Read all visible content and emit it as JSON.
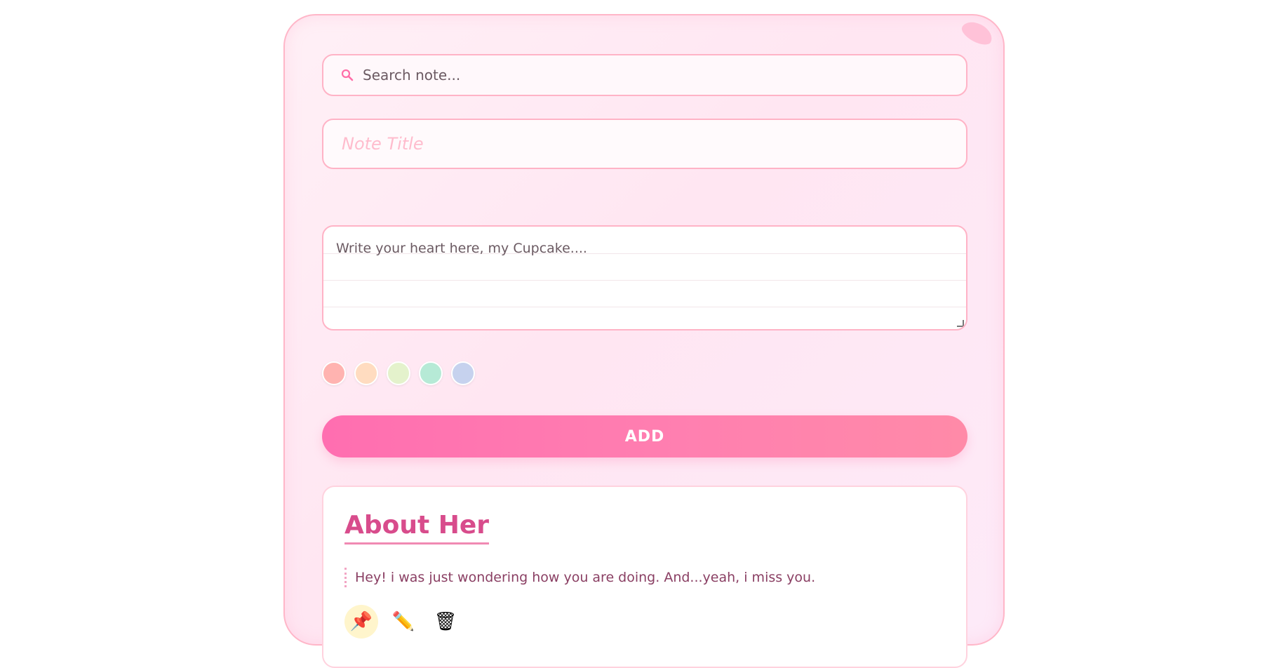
{
  "search": {
    "placeholder": "Search note..."
  },
  "editor": {
    "title_placeholder": "Note Title",
    "body_placeholder": "Write your heart here, my Cupcake...."
  },
  "colors": {
    "swatches": [
      "#ffb3b0",
      "#ffdcc0",
      "#e4f2cc",
      "#b6ead6",
      "#c6d2ee"
    ]
  },
  "actions": {
    "add_label": "ADD"
  },
  "notes": [
    {
      "title": "About Her",
      "body": "Hey! i was just wondering how you are doing. And...yeah, i miss you.",
      "pin_icon": "📌",
      "edit_icon": "✏️",
      "delete_icon": "🗑"
    }
  ],
  "theme": {
    "accent": "#ff6eb0",
    "border": "#ffb3c6",
    "title_color": "#d84c8c"
  }
}
